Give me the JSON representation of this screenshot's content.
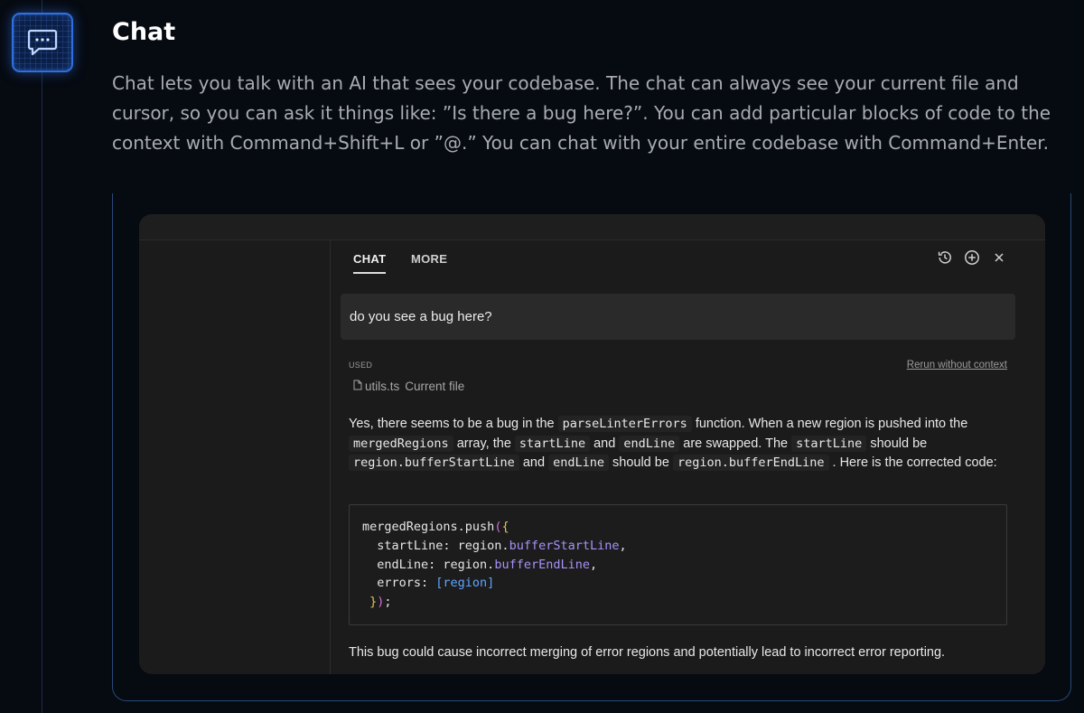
{
  "feature": {
    "title": "Chat",
    "description": "Chat lets you talk with an AI that sees your codebase. The chat can always see your current file and cursor, so you can ask it things like: ”Is there a bug here?”. You can add particular blocks of code to the context with Command+Shift+L or ”@.” You can chat with your entire codebase with Command+Enter.",
    "icon": "chat-bubble-icon"
  },
  "chat_panel": {
    "tabs": [
      {
        "label": "CHAT",
        "active": true
      },
      {
        "label": "MORE",
        "active": false
      }
    ],
    "toolbar_icons": [
      "history-icon",
      "new-chat-plus-icon",
      "close-icon"
    ],
    "user_message": "do you see a bug here?",
    "context": {
      "used_label": "USED",
      "rerun_label": "Rerun without context",
      "file_name": "utils.ts",
      "file_tag": "Current file"
    },
    "answer": {
      "p1": "Yes, there seems to be a bug in the",
      "c1": "parseLinterErrors",
      "p2": "function. When a new region is pushed into the",
      "c2": "mergedRegions",
      "p3": "array, the",
      "c3": "startLine",
      "p4": "and",
      "c4": "endLine",
      "p5": "are swapped. The",
      "c5": "startLine",
      "p6": "should be",
      "c6": "region.bufferStartLine",
      "p7": "and",
      "c7": "endLine",
      "p8": "should be",
      "c8": "region.bufferEndLine",
      "p9": ". Here is the corrected code:"
    },
    "code": {
      "l1_obj": "mergedRegions.push",
      "l1_paren": "(",
      "l1_brace": "{",
      "l2_key": "  startLine: region.",
      "l2_prop": "bufferStartLine",
      "l2_end": ",",
      "l3_key": "  endLine: region.",
      "l3_prop": "bufferEndLine",
      "l3_end": ",",
      "l4_key": "  errors: ",
      "l4_arr": "[region]",
      "l5_brace": "}",
      "l5_paren": ")",
      "l5_end": ";"
    },
    "closing": "This bug could cause incorrect merging of error regions and potentially lead to incorrect error reporting."
  },
  "colors": {
    "accent": "#2f6fe0",
    "background": "#060a11",
    "panel": "#1b1b1c"
  }
}
